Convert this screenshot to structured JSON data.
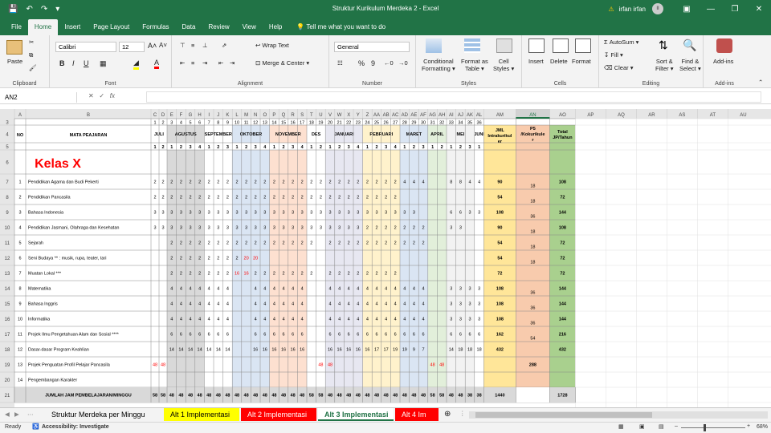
{
  "title": "Struktur Kurikulum Merdeka 2  -  Excel",
  "user": "irfan irfan",
  "avatar": "II",
  "menus": [
    "File",
    "Home",
    "Insert",
    "Page Layout",
    "Formulas",
    "Data",
    "Review",
    "View",
    "Help"
  ],
  "tell_me": "Tell me what you want to do",
  "ribbon": {
    "paste": "Paste",
    "clipboard": "Clipboard",
    "font_name": "Calibri",
    "font_size": "12",
    "font": "Font",
    "wrap": "Wrap Text",
    "merge": "Merge & Center",
    "alignment": "Alignment",
    "number_format": "General",
    "number": "Number",
    "cond": "Conditional",
    "cond2": "Formatting",
    "fmt_table": "Format as",
    "fmt_table2": "Table",
    "cell_styles": "Cell",
    "cell_styles2": "Styles",
    "styles": "Styles",
    "insert": "Insert",
    "delete": "Delete",
    "format": "Format",
    "cells": "Cells",
    "autosum": "AutoSum",
    "fill": "Fill",
    "clear": "Clear",
    "sort": "Sort &",
    "sort2": "Filter",
    "find": "Find &",
    "find2": "Select",
    "editing": "Editing",
    "addins": "Add-ins",
    "addins_group": "Add-ins"
  },
  "name_box": "AN2",
  "col_letters": [
    "A",
    "B",
    "C",
    "D",
    "E",
    "F",
    "G",
    "H",
    "I",
    "J",
    "K",
    "L",
    "M",
    "N",
    "O",
    "P",
    "Q",
    "R",
    "S",
    "T",
    "U",
    "V",
    "W",
    "X",
    "Y",
    "Z",
    "AA",
    "AB",
    "AC",
    "AD",
    "AE",
    "AF",
    "AG",
    "AH",
    "AI",
    "AJ",
    "AK",
    "AL",
    "AM",
    "AN",
    "AO",
    "AP",
    "AQ",
    "AR",
    "AS",
    "AT",
    "AU"
  ],
  "header": {
    "no": "NO",
    "mapel": "MATA PEAJARAN",
    "months": [
      "JULI",
      "AGUSTUS",
      "SEPTEMBER",
      "OKTOBER",
      "NOVEMBER",
      "DES",
      "JANUARI",
      "PEBRUARI",
      "MARET",
      "APRIL",
      "MEI",
      "JUNI"
    ],
    "jml": "JML Intrakurikuler",
    "p5": "P5 /Kokurikuler",
    "total": "Total JP/Tahun",
    "kelas": "Kelas X"
  },
  "subjects": [
    {
      "no": "1",
      "name": "Pendidikan Agama dan Budi Pekerti",
      "jml": "90",
      "p5": "18",
      "total": "108"
    },
    {
      "no": "2",
      "name": "Pendidikan Pancasila",
      "jml": "54",
      "p5": "18",
      "total": "72"
    },
    {
      "no": "3",
      "name": "Bahasa Indonesia",
      "jml": "108",
      "p5": "36",
      "total": "144"
    },
    {
      "no": "4",
      "name": "Pendidikan Jasmani, Olahraga dan Kesehatan",
      "jml": "90",
      "p5": "18",
      "total": "108"
    },
    {
      "no": "5",
      "name": "Sejarah",
      "jml": "54",
      "p5": "18",
      "total": "72"
    },
    {
      "no": "6",
      "name": "Seni Budaya ** : musik, rupa, teater, tari",
      "jml": "54",
      "p5": "18",
      "total": "72"
    },
    {
      "no": "7",
      "name": "Muatan Lokal ***",
      "jml": "72",
      "p5": "",
      "total": "72"
    },
    {
      "no": "8",
      "name": "Matematika",
      "jml": "108",
      "p5": "36",
      "total": "144"
    },
    {
      "no": "9",
      "name": "Bahasa Inggris",
      "jml": "108",
      "p5": "36",
      "total": "144"
    },
    {
      "no": "10",
      "name": "Informatika",
      "jml": "108",
      "p5": "36",
      "total": "144"
    },
    {
      "no": "11",
      "name": "Projek Ilmu Pengetahuan Alam dan Sosial ****",
      "jml": "162",
      "p5": "54",
      "total": "216"
    },
    {
      "no": "12",
      "name": "Dasar-dasar Program Keahlian",
      "jml": "432",
      "p5": "",
      "total": "432"
    },
    {
      "no": "13",
      "name": "Projek Penguatan Profil Pelajar Pancasila",
      "jml": "",
      "p5": "288",
      "total": ""
    },
    {
      "no": "14",
      "name": "Pengembangan Karakter",
      "jml": "",
      "p5": "",
      "total": ""
    }
  ],
  "total_row": {
    "label": "JUMLAH JAM PEMBELAJARAN/MINGGU",
    "jml": "1440",
    "total": "1728"
  },
  "sheets": [
    {
      "name": "Struktur Merdeka per Minggu",
      "bg": "#f3f3f3",
      "fg": "#000"
    },
    {
      "name": "Alt 1 Implementasi",
      "bg": "#ffff00",
      "fg": "#000"
    },
    {
      "name": "Alt 2 Implementasi",
      "bg": "#ff0000",
      "fg": "#fff"
    },
    {
      "name": "Alt 3 Implementasi",
      "bg": "#ffffff",
      "fg": "#217346"
    },
    {
      "name": "Alt 4 Im",
      "bg": "#ff0000",
      "fg": "#fff"
    }
  ],
  "status": {
    "ready": "Ready",
    "access": "Accessibility: Investigate",
    "zoom": "68%"
  }
}
